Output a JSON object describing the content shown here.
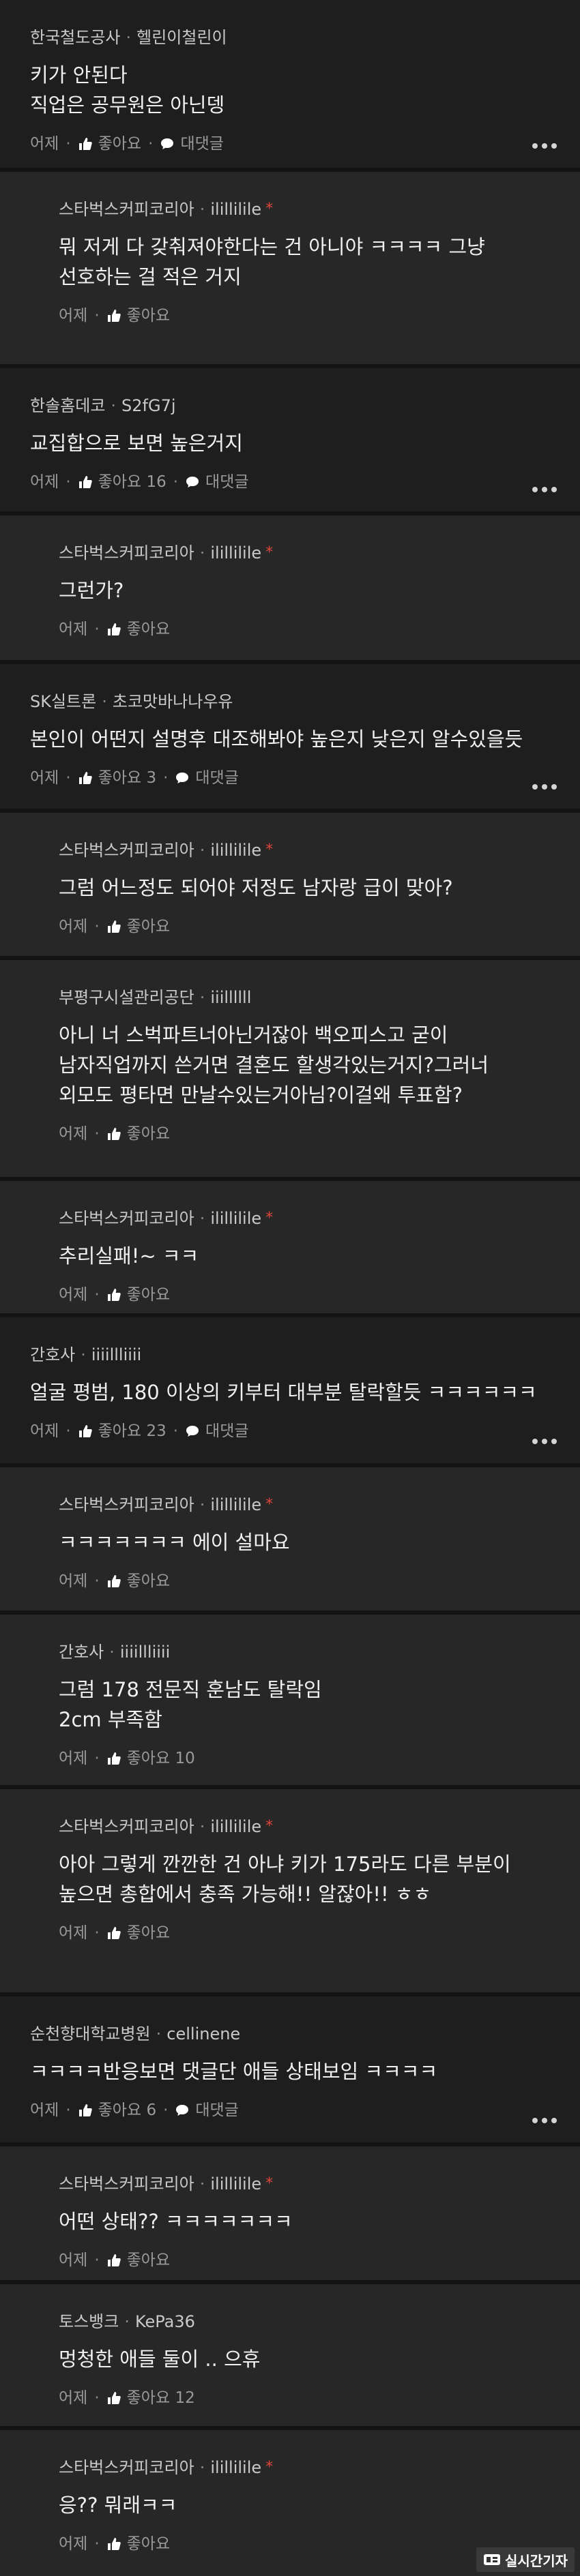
{
  "labels": {
    "time": "어제",
    "like": "좋아요",
    "reply": "대댓글",
    "op_mark": "*",
    "dot": "·"
  },
  "comments": [
    {
      "kind": "top",
      "company": "한국철도공사",
      "nick": "헬린이철린이",
      "op": false,
      "lines": "키가 안된다\n직업은 공무원은 아닌뎅",
      "likes": "",
      "reply": true
    },
    {
      "kind": "reply",
      "company": "스타벅스커피코리아",
      "nick": "ilillilile",
      "op": true,
      "lines": "뭐 저게 다 갖춰져야한다는 건 아니야 ㅋㅋㅋㅋ 그냥\n선호하는 걸 적은 거지",
      "likes": "",
      "reply": false
    },
    {
      "kind": "top",
      "company": "한솔홈데코",
      "nick": "S2fG7j",
      "op": false,
      "lines": "교집합으로 보면 높은거지",
      "likes": "16",
      "reply": true
    },
    {
      "kind": "reply",
      "company": "스타벅스커피코리아",
      "nick": "ilillilile",
      "op": true,
      "lines": "그런가?",
      "likes": "",
      "reply": false
    },
    {
      "kind": "top",
      "company": "SK실트론",
      "nick": "초코맛바나나우유",
      "op": false,
      "lines": "본인이 어떤지 설명후 대조해봐야 높은지 낮은지 알수있을듯",
      "likes": "3",
      "reply": true
    },
    {
      "kind": "reply",
      "company": "스타벅스커피코리아",
      "nick": "ilillilile",
      "op": true,
      "lines": "그럼 어느정도 되어야 저정도 남자랑 급이 맞아?",
      "likes": "",
      "reply": false
    },
    {
      "kind": "reply",
      "company": "부평구시설관리공단",
      "nick": "iiillllll",
      "op": false,
      "lines": "아니 너 스벅파트너아닌거잖아 백오피스고 굳이\n남자직업까지 쓴거면 결혼도 할생각있는거지?그러너\n외모도 평타면 만날수있는거아님?이걸왜 투표함?",
      "likes": "",
      "reply": false
    },
    {
      "kind": "reply",
      "company": "스타벅스커피코리아",
      "nick": "ilillilile",
      "op": true,
      "lines": "추리실패!~ ㅋㅋ",
      "likes": "",
      "reply": false
    },
    {
      "kind": "top",
      "company": "간호사",
      "nick": "iiiillliiii",
      "op": false,
      "lines": "얼굴 평범, 180 이상의 키부터 대부분 탈락할듯 ㅋㅋㅋㅋㅋㅋ",
      "likes": "23",
      "reply": true
    },
    {
      "kind": "reply",
      "company": "스타벅스커피코리아",
      "nick": "ilillilile",
      "op": true,
      "lines": "ㅋㅋㅋㅋㅋㅋㅋ 에이 설마요",
      "likes": "",
      "reply": false
    },
    {
      "kind": "reply",
      "company": "간호사",
      "nick": "iiiillliiii",
      "op": false,
      "lines": "그럼 178 전문직 훈남도 탈락임\n2cm 부족함",
      "likes": "10",
      "reply": false
    },
    {
      "kind": "reply",
      "company": "스타벅스커피코리아",
      "nick": "ilillilile",
      "op": true,
      "lines": "아아 그렇게 깐깐한 건 아냐 키가 175라도 다른 부분이\n높으면 총합에서 충족 가능해!! 알잖아!! ㅎㅎ",
      "likes": "",
      "reply": false
    },
    {
      "kind": "top",
      "company": "순천향대학교병원",
      "nick": "cellinene",
      "op": false,
      "lines": "ㅋㅋㅋㅋ반응보면 댓글단 애들 상태보임 ㅋㅋㅋㅋ",
      "likes": "6",
      "reply": true
    },
    {
      "kind": "reply",
      "company": "스타벅스커피코리아",
      "nick": "ilillilile",
      "op": true,
      "lines": "어떤 상태?? ㅋㅋㅋㅋㅋㅋㅋ",
      "likes": "",
      "reply": false
    },
    {
      "kind": "reply",
      "company": "토스뱅크",
      "nick": "KePa36",
      "op": false,
      "lines": "멍청한 애들 둘이 .. 으휴",
      "likes": "12",
      "reply": false
    },
    {
      "kind": "reply",
      "company": "스타벅스커피코리아",
      "nick": "ilillilile",
      "op": true,
      "lines": "응?? 뭐래ㅋㅋ",
      "likes": "",
      "reply": false
    }
  ],
  "watermark": {
    "text": "실시간기자"
  }
}
